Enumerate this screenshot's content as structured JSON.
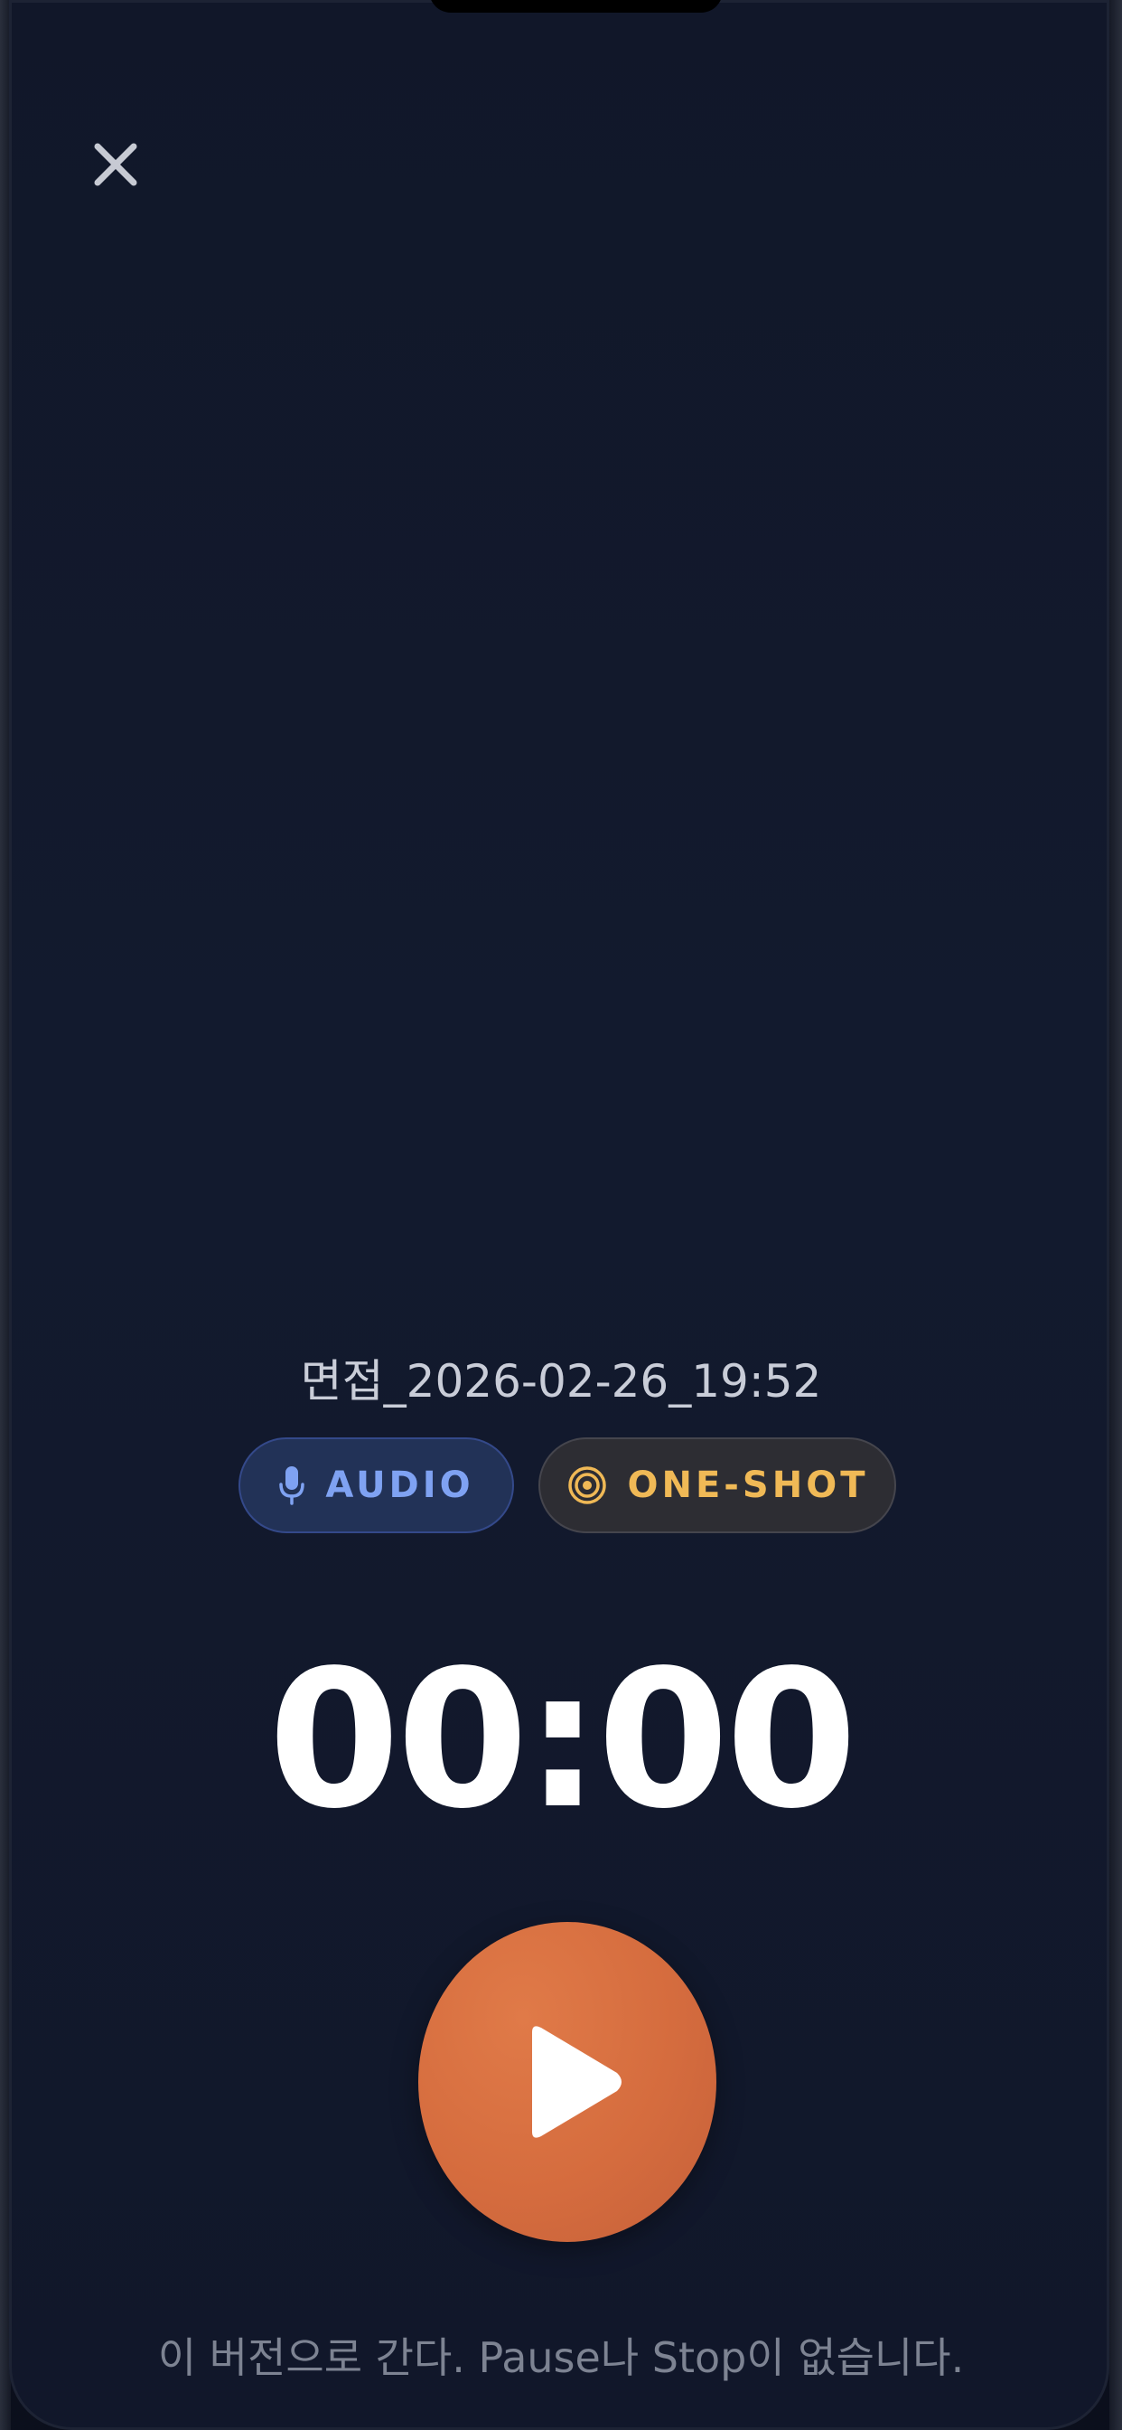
{
  "session": {
    "title": "면접_2026-02-26_19:52"
  },
  "badges": {
    "audio_label": "AUDIO",
    "oneshot_label": "ONE-SHOT",
    "audio_color": "#7fa2f2",
    "oneshot_color": "#f0b956"
  },
  "icons": {
    "close": "close-icon",
    "audio": "microphone-icon",
    "oneshot": "target-icon",
    "play": "play-icon"
  },
  "timer": {
    "value": "00:00"
  },
  "controls": {
    "play_color": "#d56c3e"
  },
  "footer": {
    "note": "이 버전으로 간다. Pause나 Stop이 없습니다."
  }
}
